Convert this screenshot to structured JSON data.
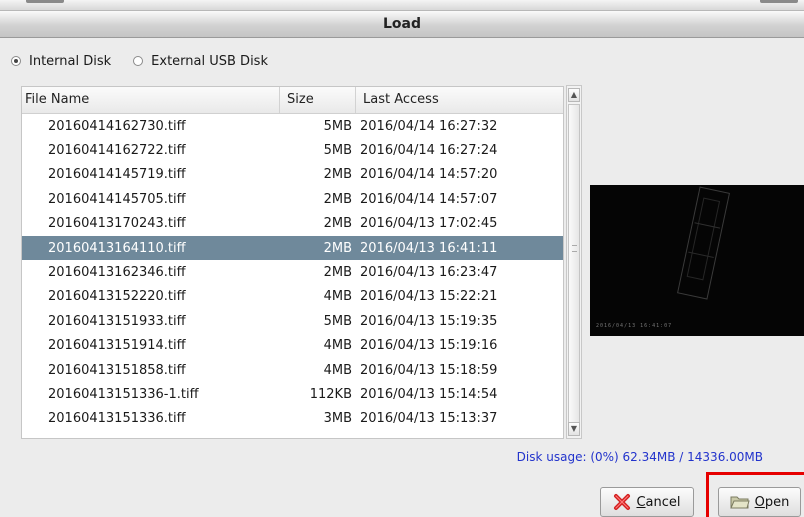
{
  "dialog": {
    "title": "Load"
  },
  "source": {
    "options": [
      "Internal Disk",
      "External USB Disk"
    ],
    "selected": "Internal Disk"
  },
  "file_list": {
    "columns": [
      "File Name",
      "Size",
      "Last Access"
    ],
    "rows": [
      {
        "name": "20160414162730.tiff",
        "size": "5MB",
        "last_access": "2016/04/14 16:27:32"
      },
      {
        "name": "20160414162722.tiff",
        "size": "5MB",
        "last_access": "2016/04/14 16:27:24"
      },
      {
        "name": "20160414145719.tiff",
        "size": "2MB",
        "last_access": "2016/04/14 14:57:20"
      },
      {
        "name": "20160414145705.tiff",
        "size": "2MB",
        "last_access": "2016/04/14 14:57:07"
      },
      {
        "name": "20160413170243.tiff",
        "size": "2MB",
        "last_access": "2016/04/13 17:02:45"
      },
      {
        "name": "20160413164110.tiff",
        "size": "2MB",
        "last_access": "2016/04/13 16:41:11"
      },
      {
        "name": "20160413162346.tiff",
        "size": "2MB",
        "last_access": "2016/04/13 16:23:47"
      },
      {
        "name": "20160413152220.tiff",
        "size": "4MB",
        "last_access": "2016/04/13 15:22:21"
      },
      {
        "name": "20160413151933.tiff",
        "size": "5MB",
        "last_access": "2016/04/13 15:19:35"
      },
      {
        "name": "20160413151914.tiff",
        "size": "4MB",
        "last_access": "2016/04/13 15:19:16"
      },
      {
        "name": "20160413151858.tiff",
        "size": "4MB",
        "last_access": "2016/04/13 15:18:59"
      },
      {
        "name": "20160413151336-1.tiff",
        "size": "112KB",
        "last_access": "2016/04/13 15:14:54"
      },
      {
        "name": "20160413151336.tiff",
        "size": "3MB",
        "last_access": "2016/04/13 15:13:37"
      }
    ],
    "selected_index": 5
  },
  "preview": {
    "stamp": "2016/04/13 16:41:07"
  },
  "disk_usage": "Disk usage: (0%) 62.34MB / 14336.00MB",
  "buttons": {
    "cancel": {
      "underline": "C",
      "rest": "ancel",
      "icon": "cancel-icon"
    },
    "open": {
      "underline": "O",
      "rest": "pen",
      "icon": "folder-icon"
    }
  },
  "colors": {
    "selection": "#6f899b",
    "disk_usage_text": "#2233cc",
    "highlight": "#e60000"
  }
}
